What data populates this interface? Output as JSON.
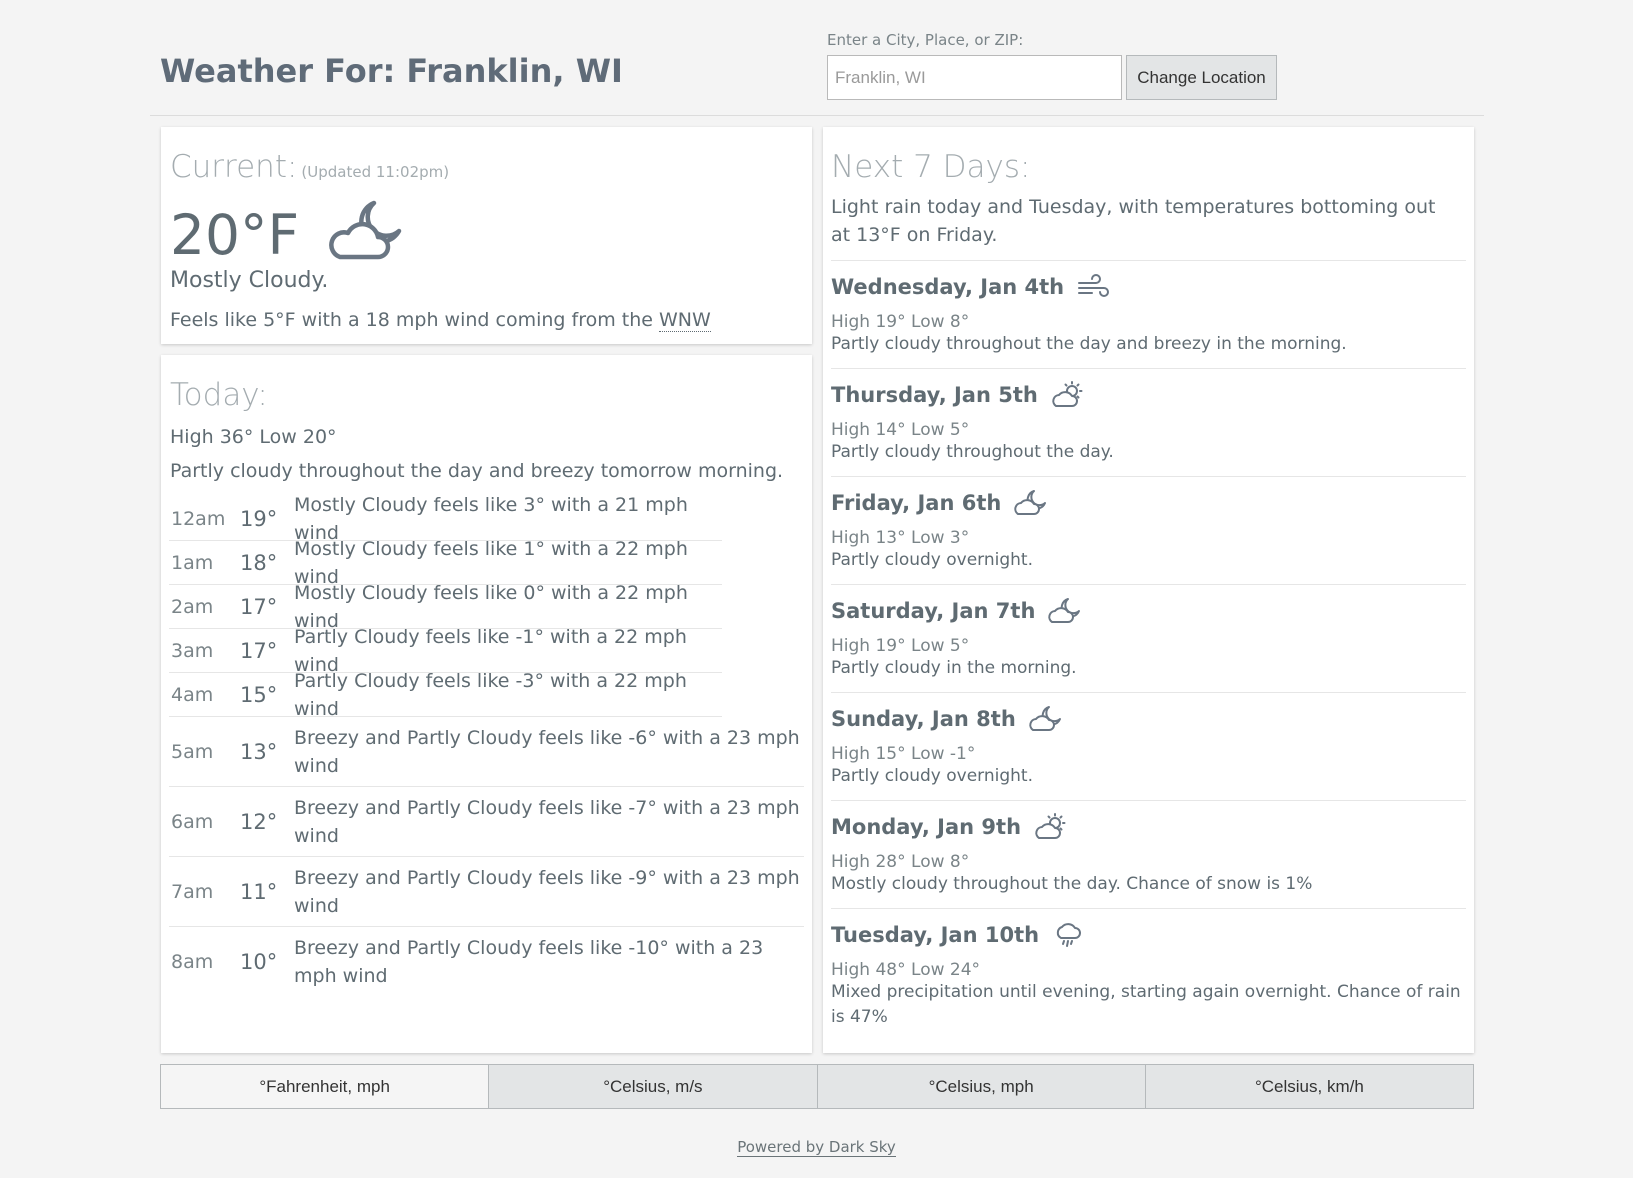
{
  "header": {
    "title": "Weather For: Franklin, WI",
    "location_label": "Enter a City, Place, or ZIP:",
    "location_placeholder": "Franklin, WI",
    "change_button": "Change Location"
  },
  "current": {
    "heading": "Current:",
    "updated": "(Updated 11:02pm)",
    "temperature": "20°F",
    "icon": "partly-cloudy-night-icon",
    "summary": "Mostly Cloudy.",
    "feels_prefix": "Feels like 5°F with a 18 mph wind coming from the",
    "wind_direction": "WNW"
  },
  "today": {
    "heading": "Today:",
    "hilo": "High 36° Low 20°",
    "summary": "Partly cloudy throughout the day and breezy tomorrow morning.",
    "hours": [
      {
        "time": "12am",
        "temp": "19°",
        "desc": "Mostly Cloudy feels like 3° with a 21 mph wind"
      },
      {
        "time": "1am",
        "temp": "18°",
        "desc": "Mostly Cloudy feels like 1° with a 22 mph wind"
      },
      {
        "time": "2am",
        "temp": "17°",
        "desc": "Mostly Cloudy feels like 0° with a 22 mph wind"
      },
      {
        "time": "3am",
        "temp": "17°",
        "desc": "Partly Cloudy feels like -1° with a 22 mph wind"
      },
      {
        "time": "4am",
        "temp": "15°",
        "desc": "Partly Cloudy feels like -3° with a 22 mph wind"
      },
      {
        "time": "5am",
        "temp": "13°",
        "desc": "Breezy and Partly Cloudy feels like -6° with a 23 mph wind"
      },
      {
        "time": "6am",
        "temp": "12°",
        "desc": "Breezy and Partly Cloudy feels like -7° with a 23 mph wind"
      },
      {
        "time": "7am",
        "temp": "11°",
        "desc": "Breezy and Partly Cloudy feels like -9° with a 23 mph wind"
      },
      {
        "time": "8am",
        "temp": "10°",
        "desc": "Breezy and Partly Cloudy feels like -10° with a 23 mph wind"
      }
    ]
  },
  "week": {
    "heading": "Next 7 Days:",
    "summary": "Light rain today and Tuesday, with temperatures bottoming out at 13°F on Friday.",
    "days": [
      {
        "name": "Wednesday, Jan 4th",
        "icon": "wind-icon",
        "high": "19°",
        "low": "8°",
        "desc": "Partly cloudy throughout the day and breezy in the morning."
      },
      {
        "name": "Thursday, Jan 5th",
        "icon": "partly-cloudy-day-icon",
        "high": "14°",
        "low": "5°",
        "desc": "Partly cloudy throughout the day."
      },
      {
        "name": "Friday, Jan 6th",
        "icon": "partly-cloudy-night-icon",
        "high": "13°",
        "low": "3°",
        "desc": "Partly cloudy overnight."
      },
      {
        "name": "Saturday, Jan 7th",
        "icon": "partly-cloudy-night-icon",
        "high": "19°",
        "low": "5°",
        "desc": "Partly cloudy in the morning."
      },
      {
        "name": "Sunday, Jan 8th",
        "icon": "partly-cloudy-night-icon",
        "high": "15°",
        "low": "-1°",
        "desc": "Partly cloudy overnight."
      },
      {
        "name": "Monday, Jan 9th",
        "icon": "partly-cloudy-day-icon",
        "high": "28°",
        "low": "8°",
        "desc": "Mostly cloudy throughout the day. Chance of snow is 1%"
      },
      {
        "name": "Tuesday, Jan 10th",
        "icon": "sleet-icon",
        "high": "48°",
        "low": "24°",
        "desc": "Mixed precipitation until evening, starting again overnight. Chance of rain is 47%"
      }
    ],
    "high_label": "High",
    "low_label": "Low"
  },
  "units": [
    {
      "label": "°Fahrenheit, mph",
      "active": true
    },
    {
      "label": "°Celsius, m/s",
      "active": false
    },
    {
      "label": "°Celsius, mph",
      "active": false
    },
    {
      "label": "°Celsius, km/h",
      "active": false
    }
  ],
  "footer": {
    "powered_by": "Powered by Dark Sky"
  },
  "colors": {
    "text": "#5f6b72",
    "heading_light": "#a4acb0",
    "background": "#f4f4f4"
  }
}
